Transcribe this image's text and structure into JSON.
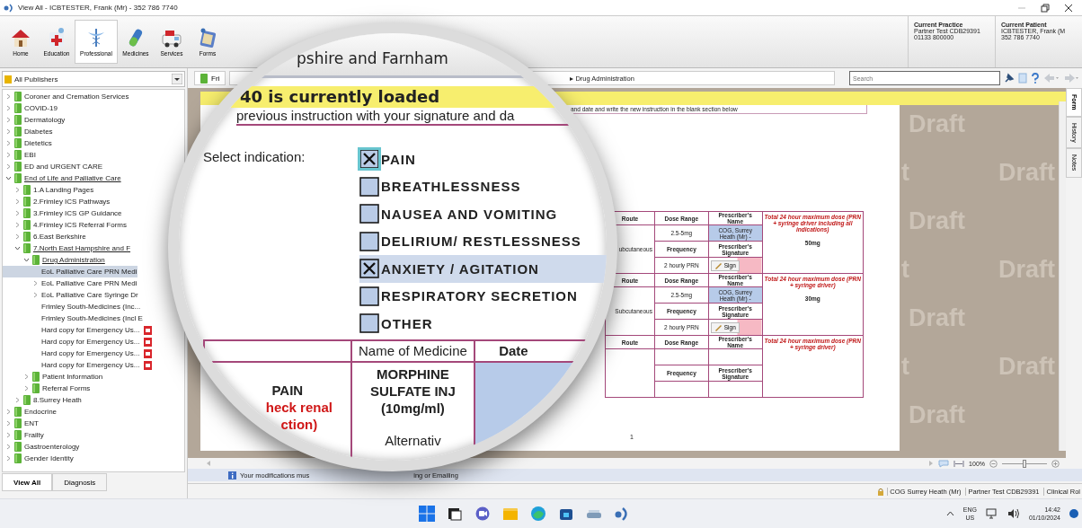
{
  "window": {
    "title": "View All - ICBTESTER, Frank (Mr) - 352 786 7740"
  },
  "toolbar": [
    {
      "label": "Home",
      "selected": false
    },
    {
      "label": "Education",
      "selected": false
    },
    {
      "label": "Professional",
      "selected": true
    },
    {
      "label": "Medicines",
      "selected": false
    },
    {
      "label": "Services",
      "selected": false
    },
    {
      "label": "Forms",
      "selected": false
    }
  ],
  "current_practice": {
    "heading": "Current Practice",
    "lines": [
      "Partner Test CDB29391",
      "01133 800000"
    ]
  },
  "current_patient": {
    "heading": "Current Patient",
    "lines": [
      "ICBTESTER, Frank (M",
      "352 786 7740"
    ]
  },
  "sidebar": {
    "publisher": "All Publishers",
    "tree": [
      {
        "label": "Coroner and Cremation Services",
        "kind": "folder",
        "expanded": false,
        "selected": false
      },
      {
        "label": "COVID-19",
        "kind": "folder",
        "expanded": false,
        "selected": false
      },
      {
        "label": "Dermatology",
        "kind": "folder",
        "expanded": false,
        "selected": false
      },
      {
        "label": "Diabetes",
        "kind": "folder",
        "expanded": false,
        "selected": false
      },
      {
        "label": "Dietetics",
        "kind": "folder",
        "expanded": false,
        "selected": false
      },
      {
        "label": "EBI",
        "kind": "folder",
        "expanded": false,
        "selected": false
      },
      {
        "label": "ED and URGENT CARE",
        "kind": "folder",
        "expanded": false,
        "selected": false
      },
      {
        "label": "End of Life and Palliative Care",
        "kind": "folder",
        "expanded": true,
        "selected": false,
        "children": [
          {
            "label": "1.A Landing Pages",
            "kind": "folder",
            "expanded": false,
            "selected": false
          },
          {
            "label": "2.Frimley ICS Pathways",
            "kind": "folder",
            "expanded": false,
            "selected": false
          },
          {
            "label": "3.Frimley ICS GP Guidance",
            "kind": "folder",
            "expanded": false,
            "selected": false
          },
          {
            "label": "4.Frimley ICS Referral Forms",
            "kind": "folder",
            "expanded": false,
            "selected": false
          },
          {
            "label": "6.East Berkshire",
            "kind": "folder",
            "expanded": false,
            "selected": false
          },
          {
            "label": "7.North East Hampshire and F",
            "kind": "folder",
            "expanded": true,
            "selected": false,
            "children": [
              {
                "label": "Drug Administration",
                "kind": "folder",
                "expanded": true,
                "selected": false,
                "children": [
                  {
                    "label": "EoL Palliative Care PRN Medi",
                    "kind": "doc",
                    "selected": true
                  },
                  {
                    "label": "EoL Palliative Care PRN Medi",
                    "kind": "page",
                    "expanded": false,
                    "selected": false
                  },
                  {
                    "label": "EoL Palliative Care Syringe Dr",
                    "kind": "page",
                    "expanded": false,
                    "selected": false
                  },
                  {
                    "label": "Frimley South-Medicines (Inc...",
                    "kind": "doc",
                    "selected": false
                  },
                  {
                    "label": "Frimley South-Medicines (Incl E",
                    "kind": "doc",
                    "selected": false
                  },
                  {
                    "label": "Hard copy for Emergency Us...",
                    "kind": "pdf",
                    "selected": false
                  },
                  {
                    "label": "Hard copy for Emergency Us...",
                    "kind": "pdf",
                    "selected": false
                  },
                  {
                    "label": "Hard copy for Emergency Us...",
                    "kind": "pdf",
                    "selected": false
                  },
                  {
                    "label": "Hard copy for Emergency Us...",
                    "kind": "pdf",
                    "selected": false
                  }
                ]
              },
              {
                "label": "Patient Information",
                "kind": "folder",
                "expanded": false,
                "selected": false
              },
              {
                "label": "Referral Forms",
                "kind": "folder",
                "expanded": false,
                "selected": false
              }
            ]
          },
          {
            "label": "8.Surrey Heath",
            "kind": "folder",
            "expanded": false,
            "selected": false
          }
        ]
      },
      {
        "label": "Endocrine",
        "kind": "folder",
        "expanded": false,
        "selected": false
      },
      {
        "label": "ENT",
        "kind": "folder",
        "expanded": false,
        "selected": false
      },
      {
        "label": "Frailty",
        "kind": "folder",
        "expanded": false,
        "selected": false
      },
      {
        "label": "Gastroenterology",
        "kind": "folder",
        "expanded": false,
        "selected": false
      },
      {
        "label": "Gender Identity",
        "kind": "folder",
        "expanded": false,
        "selected": false
      }
    ],
    "tabs": [
      {
        "label": "View All",
        "selected": true
      },
      {
        "label": "Diagnosis",
        "selected": false
      }
    ]
  },
  "document_tab": {
    "label": "Fri"
  },
  "breadcrumb": "▸ Drug Administration",
  "search": {
    "placeholder": "Search"
  },
  "side_tabs": [
    {
      "label": "Form",
      "selected": true
    },
    {
      "label": "History",
      "selected": false
    },
    {
      "label": "Notes",
      "selected": false
    }
  ],
  "instruction": "and date and write the new instruction in the blank section below",
  "table_blocks": [
    {
      "headers": [
        "Route",
        "Dose Range",
        "Prescriber's Name"
      ],
      "route": "ubcutaneous",
      "dose_range": "2.5-5mg",
      "prescriber": "COG, Surrey Heath (Mr) -",
      "frequency_label": "Frequency",
      "signature_label": "Prescriber's Signature",
      "frequency": "2 hourly PRN",
      "sign": "Sign",
      "max_note": "Total 24 hour maximum dose (PRN + syringe driver including all indications)",
      "max_dose": "50mg"
    },
    {
      "headers": [
        "Route",
        "Dose Range",
        "Prescriber's Name"
      ],
      "route": "Subcutaneous",
      "dose_range": "2.5-5mg",
      "prescriber": "COG, Surrey Heath (Mr) -",
      "frequency_label": "Frequency",
      "signature_label": "Prescriber's Signature",
      "frequency": "2 hourly PRN",
      "sign": "Sign",
      "max_note": "Total 24 hour maximum dose (PRN + syringe driver)",
      "max_dose": "30mg"
    },
    {
      "headers": [
        "Route",
        "Dose Range",
        "Prescriber's Name"
      ],
      "frequency_label": "Frequency",
      "signature_label": "Prescriber's Signature",
      "max_note": "Total 24 hour maximum dose (PRN + syringe driver)"
    }
  ],
  "page_number": "1",
  "watermark_rows": [
    [
      "Draft"
    ],
    [
      "t",
      "Draft"
    ],
    [
      "Draft"
    ],
    [
      "t",
      "Draft"
    ],
    [
      "Draft"
    ],
    [
      "t",
      "Draft"
    ],
    [
      "Draft"
    ]
  ],
  "zoom": {
    "value": "100%",
    "level": 0.5
  },
  "info_bar": [
    "Your modifications mus",
    "ing or Emailing"
  ],
  "status_bar": [
    "COG Surrey Heath (Mr)",
    "Partner Test CDB29391",
    "Clinical Rol"
  ],
  "magnifier": {
    "header": "pshire and Farnham",
    "banner": "40 is currently loaded",
    "instruction": "previous instruction with your signature and da",
    "prompt": "Select indication:",
    "indications": [
      {
        "label": "PAIN",
        "checked": true,
        "highlighted": false
      },
      {
        "label": "BREATHLESSNESS",
        "checked": false,
        "highlighted": false
      },
      {
        "label": "NAUSEA AND VOMITING",
        "checked": false,
        "highlighted": false
      },
      {
        "label": "DELIRIUM/ RESTLESSNESS",
        "checked": false,
        "highlighted": false
      },
      {
        "label": "ANXIETY / AGITATION",
        "checked": true,
        "highlighted": true
      },
      {
        "label": "RESPIRATORY SECRETION",
        "checked": false,
        "highlighted": false
      },
      {
        "label": "OTHER",
        "checked": false,
        "highlighted": false
      }
    ],
    "columns": [
      "Name of Medicine",
      "Date"
    ],
    "indication": "PAIN",
    "note_lines": [
      "heck renal",
      "ction)"
    ],
    "medicine": "MORPHINE SULFATE INJ (10mg/ml)",
    "alternative": "Alternativ"
  },
  "taskbar": {
    "language": [
      "ENG",
      "US"
    ],
    "time": "14:42",
    "date": "01/10/2024"
  }
}
